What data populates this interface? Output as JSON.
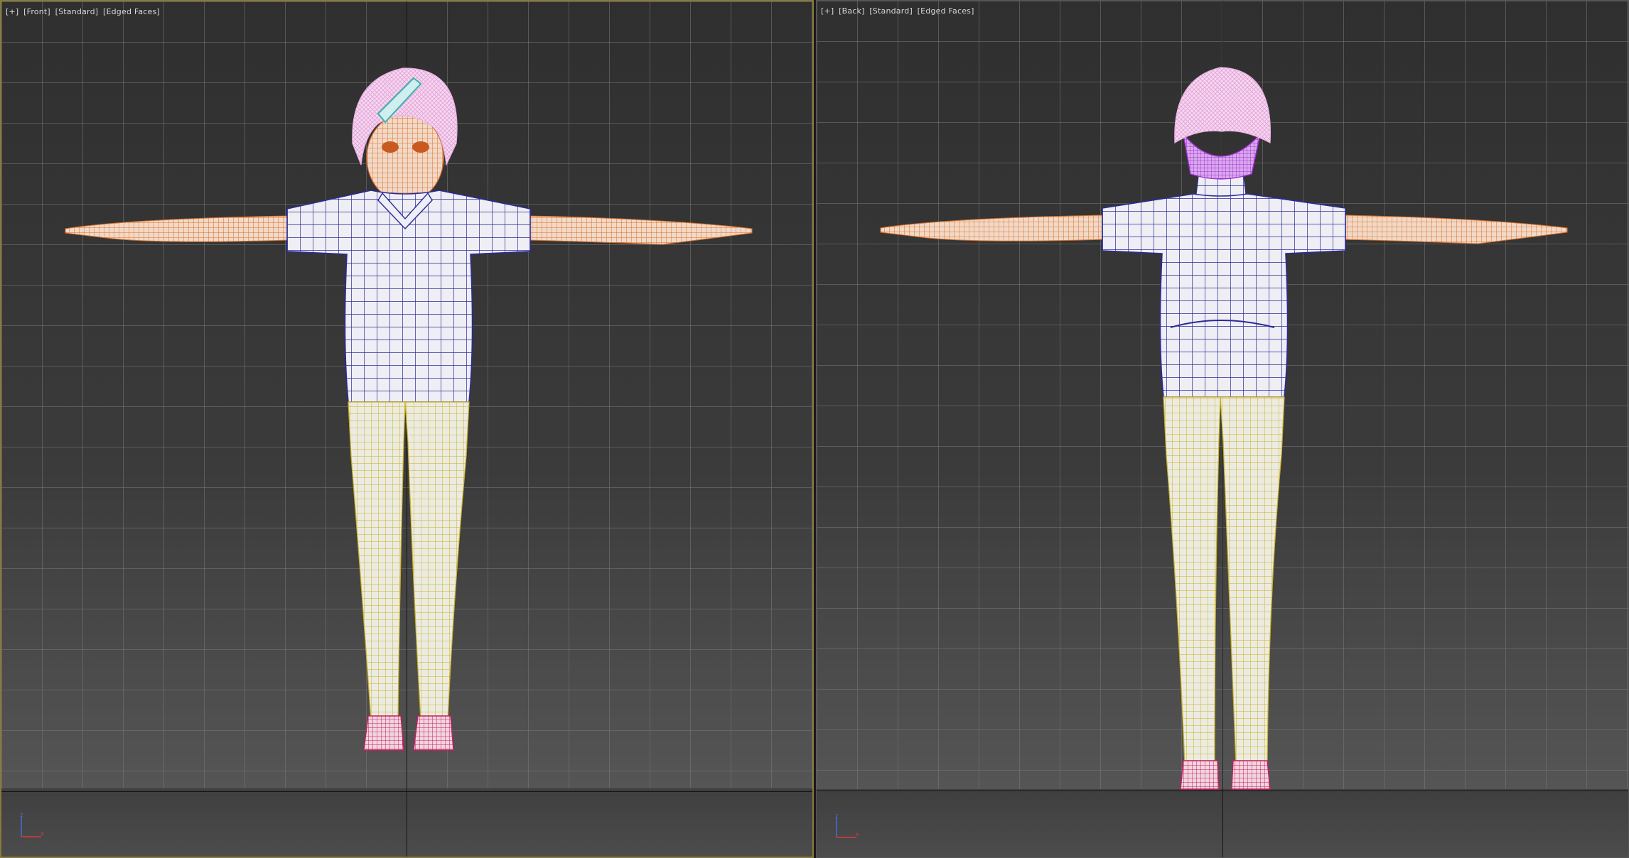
{
  "viewports": {
    "front": {
      "label_plus": "[+]",
      "label_view": "[Front]",
      "label_shading": "[Standard]",
      "label_edged": "[Edged Faces]"
    },
    "back": {
      "label_plus": "[+]",
      "label_view": "[Back]",
      "label_shading": "[Standard]",
      "label_edged": "[Edged Faces]"
    }
  },
  "colors": {
    "background_top": "#2f2f2f",
    "background_bottom": "#5b5b5b",
    "grid_line": "#787878",
    "active_viewport_border": "#8a7a3a",
    "skin_wire": "#d8702a",
    "shirt_wire": "#2a2a9a",
    "pants_wire": "#c8b020",
    "shoes_wire": "#c02060",
    "hair": "#f0c0e8",
    "hair_back_wire": "#a030d0",
    "headband": "#40b0b0"
  },
  "icons": {
    "axis_gizmo": "axis-tripod-icon"
  }
}
